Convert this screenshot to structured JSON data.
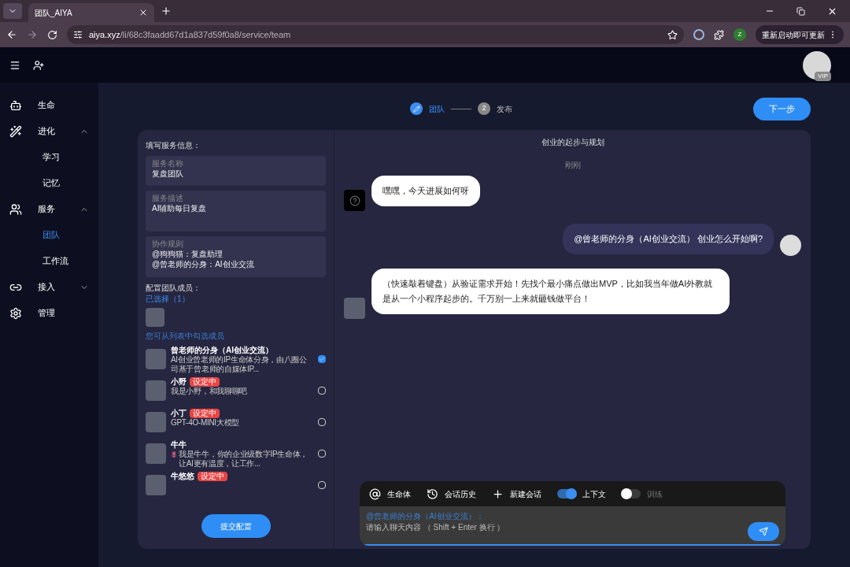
{
  "browser": {
    "tab_title": "团队_AIYA",
    "url_host": "aiya.xyz",
    "url_path": "/li/68c3faadd67d1a837d59f0a8/service/team",
    "profile_letter": "Z",
    "update_button": "重新启动即可更新"
  },
  "header": {
    "avatar_badge": "VIP"
  },
  "sidebar": [
    {
      "label": "生命",
      "selected": false
    },
    {
      "label": "进化",
      "expanded": true,
      "selected": false,
      "children": [
        {
          "label": "学习",
          "selected": false
        },
        {
          "label": "记忆",
          "selected": false
        }
      ]
    },
    {
      "label": "服务",
      "expanded": true,
      "selected": false,
      "children": [
        {
          "label": "团队",
          "selected": true
        },
        {
          "label": "工作流",
          "selected": false
        }
      ]
    },
    {
      "label": "接入",
      "expanded": false,
      "selected": false
    },
    {
      "label": "管理",
      "selected": false
    }
  ],
  "steps": [
    {
      "kind": "edit",
      "label": "团队",
      "selected": true
    },
    {
      "kind": "number",
      "number": "2",
      "label": "发布",
      "selected": false
    }
  ],
  "next_button": "下一步",
  "form": {
    "heading": "填写服务信息：",
    "fields": [
      {
        "label": "服务名称",
        "value": "复盘团队",
        "kind": "input"
      },
      {
        "label": "服务描述",
        "value": "AI辅助每日复盘",
        "kind": "textarea"
      },
      {
        "label": "协作规则",
        "value": "@狗狗猫：复盘助理\n@曾老师的分身：AI创业交流",
        "kind": "textarea"
      }
    ],
    "members_heading": "配置团队成员：",
    "selected_count": "已选择（1）",
    "hint": "您可从列表中勾选成员",
    "members": [
      {
        "name": "曾老师的分身（AI创业交流）",
        "description": "AI创业曾老师的IP生命体分身，由八圈公司基于曾老师的自媒体IP...",
        "checked": true,
        "flower": false
      },
      {
        "name": "小野",
        "badge": "设定中",
        "description": "我是小野，和我聊聊吧",
        "checked": false,
        "flower": false
      },
      {
        "name": "小丁",
        "badge": "设定中",
        "description": "GPT-4O-MINI大模型",
        "checked": false,
        "flower": false
      },
      {
        "name": "牛牛",
        "description": "我是牛牛，你的企业级数字IP生命体，让AI更有温度，让工作...",
        "checked": false,
        "flower": true
      },
      {
        "name": "牛悠悠",
        "badge": "设定中",
        "checked": false,
        "flower": false
      }
    ],
    "submit": "提交配置"
  },
  "chat": {
    "title": "创业的起步与规划",
    "time": "刚刚",
    "messages": [
      {
        "kind": "unknown",
        "text": "嘿嘿，今天进展如何呀"
      },
      {
        "kind": "user",
        "text": "@曾老师的分身（AI创业交流） 创业怎么开始啊?"
      },
      {
        "kind": "agent",
        "text": "（快速敲着键盘）从验证需求开始！先找个最小痛点做出MVP，比如我当年做AI外教就是从一个小程序起步的。千万别一上来就砸钱做平台！"
      }
    ],
    "toolbar": [
      {
        "kind": "action",
        "label": "生命体"
      },
      {
        "kind": "action",
        "label": "会话历史"
      },
      {
        "kind": "action",
        "label": "新建会话"
      },
      {
        "kind": "toggle",
        "label": "上下文",
        "on": true
      },
      {
        "kind": "toggle",
        "label": "训练",
        "on": false
      }
    ],
    "input": {
      "mention": "@曾老师的分身（AI创业交流）：",
      "placeholder": "请输入聊天内容 （ Shift + Enter 换行 ）"
    }
  }
}
